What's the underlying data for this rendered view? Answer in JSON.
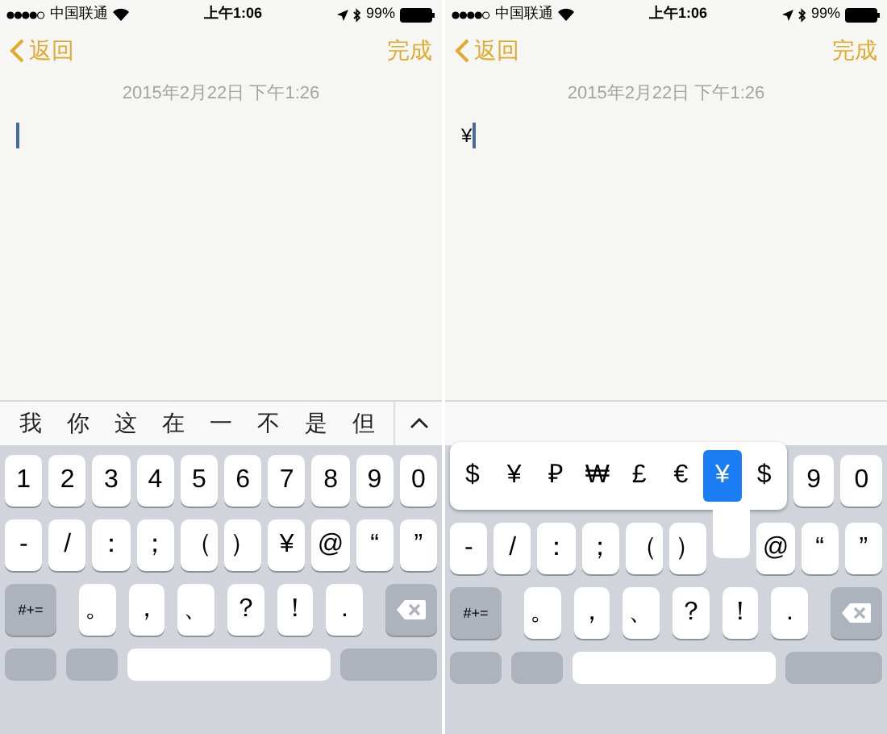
{
  "panes": [
    {
      "status_bar": {
        "carrier": "中国联通",
        "time": "上午1:06",
        "battery": "99%"
      },
      "nav": {
        "back": "返回",
        "done": "完成"
      },
      "date": "2015年2月22日 下午1:26",
      "candidates": [
        "我",
        "你",
        "这",
        "在",
        "一",
        "不",
        "是",
        "但"
      ],
      "keyboard": [
        [
          {
            "kind": "char",
            "label": "1"
          },
          {
            "kind": "char",
            "label": "2"
          },
          {
            "kind": "char",
            "label": "3"
          },
          {
            "kind": "char",
            "label": "4"
          },
          {
            "kind": "char",
            "label": "5"
          },
          {
            "kind": "char",
            "label": "6"
          },
          {
            "kind": "char",
            "label": "7"
          },
          {
            "kind": "char",
            "label": "8"
          },
          {
            "kind": "char",
            "label": "9"
          },
          {
            "kind": "char",
            "label": "0"
          }
        ],
        [
          {
            "kind": "char",
            "label": "-"
          },
          {
            "kind": "char",
            "label": "/"
          },
          {
            "kind": "char",
            "label": "："
          },
          {
            "kind": "char",
            "label": "；"
          },
          {
            "kind": "char",
            "label": "（"
          },
          {
            "kind": "char",
            "label": "）"
          },
          {
            "kind": "char",
            "label": "¥"
          },
          {
            "kind": "char",
            "label": "@"
          },
          {
            "kind": "char",
            "label": "“"
          },
          {
            "kind": "char",
            "label": "”"
          }
        ],
        [
          {
            "kind": "mode",
            "label": "#+="
          },
          {
            "kind": "char",
            "label": "。"
          },
          {
            "kind": "char",
            "label": "，"
          },
          {
            "kind": "char",
            "label": "、"
          },
          {
            "kind": "char",
            "label": "？"
          },
          {
            "kind": "char",
            "label": "！"
          },
          {
            "kind": "char",
            "label": "."
          },
          {
            "kind": "delete"
          }
        ]
      ]
    },
    {
      "status_bar": {
        "carrier": "中国联通",
        "time": "上午1:06",
        "battery": "99%"
      },
      "nav": {
        "back": "返回",
        "done": "完成"
      },
      "date": "2015年2月22日 下午1:26",
      "note_text": "¥",
      "keyboard": [
        [
          {
            "kind": "popup",
            "options": [
              {
                "label": "$",
                "selected": false
              },
              {
                "label": "¥",
                "selected": false
              },
              {
                "label": "₽",
                "selected": false
              },
              {
                "label": "₩",
                "selected": false
              },
              {
                "label": "£",
                "selected": false
              },
              {
                "label": "€",
                "selected": false
              },
              {
                "label": "¥",
                "selected": true
              },
              {
                "label": "$",
                "selected": false
              }
            ]
          },
          {
            "kind": "char",
            "label": "9"
          },
          {
            "kind": "char",
            "label": "0"
          }
        ],
        [
          {
            "kind": "char",
            "label": "-"
          },
          {
            "kind": "char",
            "label": "/"
          },
          {
            "kind": "char",
            "label": "："
          },
          {
            "kind": "char",
            "label": "；"
          },
          {
            "kind": "char",
            "label": "（"
          },
          {
            "kind": "char",
            "label": "）"
          },
          {
            "kind": "stem"
          },
          {
            "kind": "char",
            "label": "@"
          },
          {
            "kind": "char",
            "label": "“"
          },
          {
            "kind": "char",
            "label": "”"
          }
        ],
        [
          {
            "kind": "mode",
            "label": "#+="
          },
          {
            "kind": "char",
            "label": "。"
          },
          {
            "kind": "char",
            "label": "，"
          },
          {
            "kind": "char",
            "label": "、"
          },
          {
            "kind": "char",
            "label": "？"
          },
          {
            "kind": "char",
            "label": "！"
          },
          {
            "kind": "char",
            "label": "."
          },
          {
            "kind": "delete"
          }
        ]
      ]
    }
  ]
}
